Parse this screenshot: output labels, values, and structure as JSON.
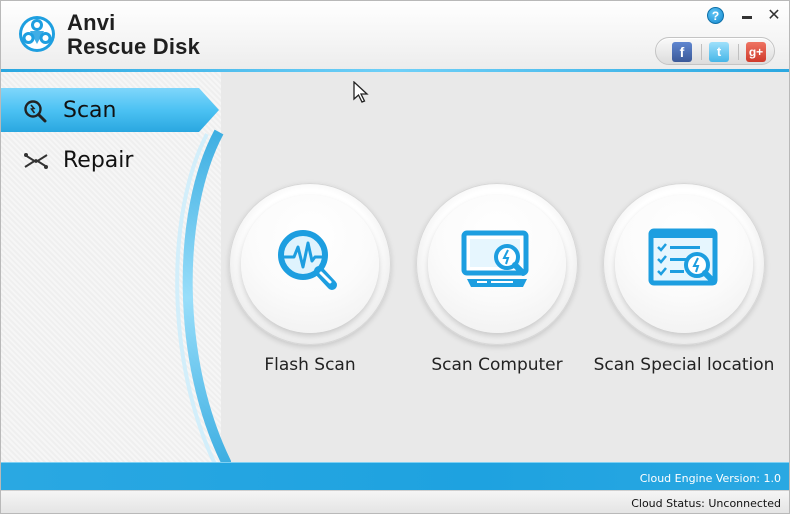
{
  "app": {
    "title_line1": "Anvi",
    "title_line2": "Rescue Disk",
    "help_label": "?",
    "close_label": "✕"
  },
  "social": [
    {
      "name": "facebook",
      "glyph": "f"
    },
    {
      "name": "twitter",
      "glyph": "t"
    },
    {
      "name": "google-plus",
      "glyph": "g+"
    }
  ],
  "sidebar": {
    "items": [
      {
        "label": "Scan",
        "active": true,
        "icon": "scan-magnifier-icon"
      },
      {
        "label": "Repair",
        "active": false,
        "icon": "repair-icon"
      }
    ]
  },
  "scan_options": [
    {
      "label": "Flash Scan",
      "icon": "flash-scan-icon"
    },
    {
      "label": "Scan Computer",
      "icon": "scan-computer-icon"
    },
    {
      "label": "Scan Special location",
      "icon": "scan-special-location-icon"
    }
  ],
  "footer": {
    "engine_version": "Cloud Engine Version: 1.0",
    "cloud_status": "Cloud Status: Unconnected"
  },
  "colors": {
    "accent": "#1ea2e0",
    "accent_light": "#6fd0f8",
    "icon_blue": "#1d9ee0"
  }
}
